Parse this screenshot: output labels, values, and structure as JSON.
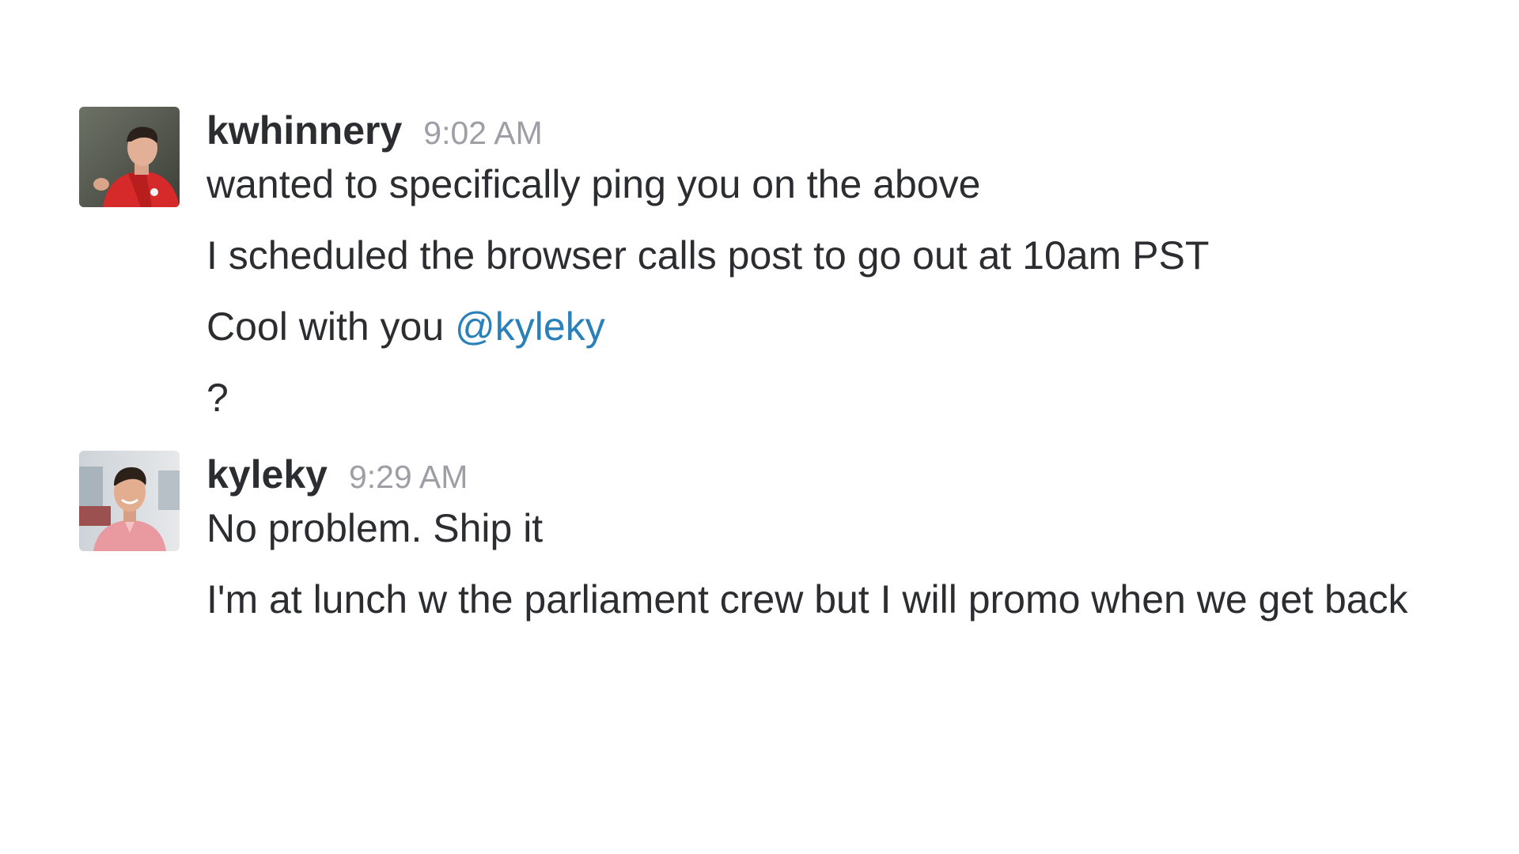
{
  "messages": [
    {
      "username": "kwhinnery",
      "time": "9:02 AM",
      "lines": [
        "wanted to specifically ping you on the above",
        "I scheduled the browser calls post to go out at 10am PST"
      ],
      "mention_line": {
        "text": "Cool with you ",
        "mention": "@kyleky"
      },
      "last_line": "?"
    },
    {
      "username": "kyleky",
      "time": "9:29 AM",
      "lines": [
        "No problem. Ship it",
        "I'm at lunch w the parliament crew but I will promo when we get back"
      ]
    }
  ],
  "colors": {
    "text": "#2c2d30",
    "timestamp": "#9e9ea6",
    "mention": "#2a80b9",
    "background": "#ffffff"
  }
}
